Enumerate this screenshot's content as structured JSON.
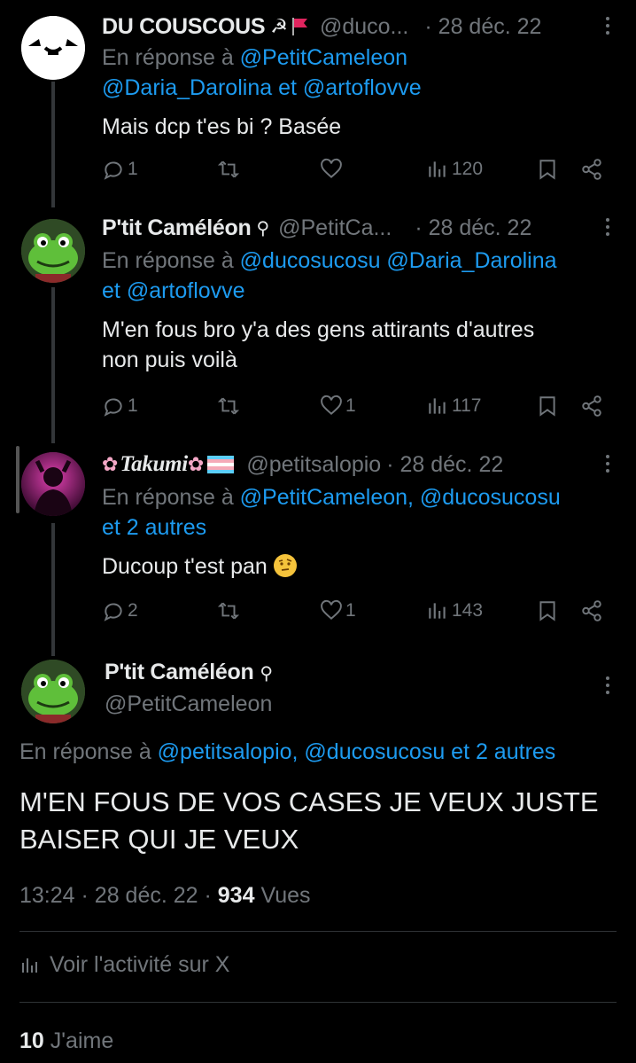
{
  "tweets": [
    {
      "name": "DU COUSCOUS",
      "handle": "@duco...",
      "date": "· 28 déc. 22",
      "reply_prefix": "En réponse à",
      "reply_line1": "@PetitCameleon",
      "reply_line2": "@Daria_Darolina et @artoflovve",
      "text": "Mais dcp t'es bi ? Basée",
      "replies": "1",
      "retweets": "",
      "likes": "",
      "views": "120"
    },
    {
      "name": "P'tit Caméléon",
      "handle": "@PetitCa...",
      "date": "· 28 déc. 22",
      "reply_prefix": "En réponse à",
      "reply_line1": "@ducosucosu @Daria_Darolina",
      "reply_line2": "@artoflovve",
      "reply_et": "et",
      "text_line1": "M'en fous bro y'a des gens attirants d'autres",
      "text_line2": "non puis voilà",
      "replies": "1",
      "retweets": "",
      "likes": "1",
      "views": "117"
    },
    {
      "name": "Takumi",
      "handle": "@petitsalopio",
      "date": "· 28 déc. 22",
      "reply_prefix": "En réponse à",
      "reply_line1": "@PetitCameleon, @ducosucosu",
      "reply_line2": "et 2 autres",
      "text": "Ducoup t'est pan",
      "replies": "2",
      "retweets": "",
      "likes": "1",
      "views": "143"
    }
  ],
  "main_tweet": {
    "name": "P'tit Caméléon",
    "handle": "@PetitCameleon",
    "reply_prefix": "En réponse à",
    "reply_links": "@petitsalopio, @ducosucosu et 2 autres",
    "text_line1": "M'EN FOUS DE VOS CASES JE VEUX JUSTE",
    "text_line2": "BAISER QUI JE VEUX",
    "time": "13:24",
    "date": "· 28 déc. 22 ·",
    "views_count": "934",
    "views_label": "Vues",
    "activity_label": "Voir l'activité sur X",
    "likes_count": "10",
    "likes_label": "J'aime"
  },
  "colors": {
    "background": "#000000",
    "text": "#e7e9ea",
    "muted": "#71767b",
    "link": "#1d9bf0",
    "divider": "#2f3336"
  }
}
